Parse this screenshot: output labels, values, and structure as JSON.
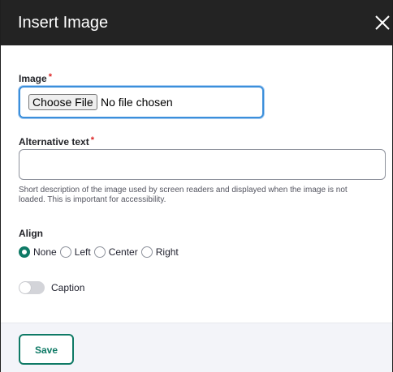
{
  "dialog": {
    "title": "Insert Image",
    "close_icon": "close-icon"
  },
  "image_field": {
    "label": "Image",
    "required_marker": "*",
    "button_label": "Choose File",
    "status_text": "No file chosen",
    "focus_color": "#3b8fdb"
  },
  "alt_text_field": {
    "label": "Alternative text",
    "required_marker": "*",
    "value": "",
    "description": "Short description of the image used by screen readers and displayed when the image is not loaded. This is important for accessibility."
  },
  "align": {
    "label": "Align",
    "options": [
      {
        "label": "None",
        "checked": true
      },
      {
        "label": "Left",
        "checked": false
      },
      {
        "label": "Center",
        "checked": false
      },
      {
        "label": "Right",
        "checked": false
      }
    ],
    "checked_color": "#0f7a66"
  },
  "caption": {
    "label": "Caption",
    "enabled": false
  },
  "footer": {
    "save_label": "Save",
    "accent_color": "#0f7a66"
  }
}
